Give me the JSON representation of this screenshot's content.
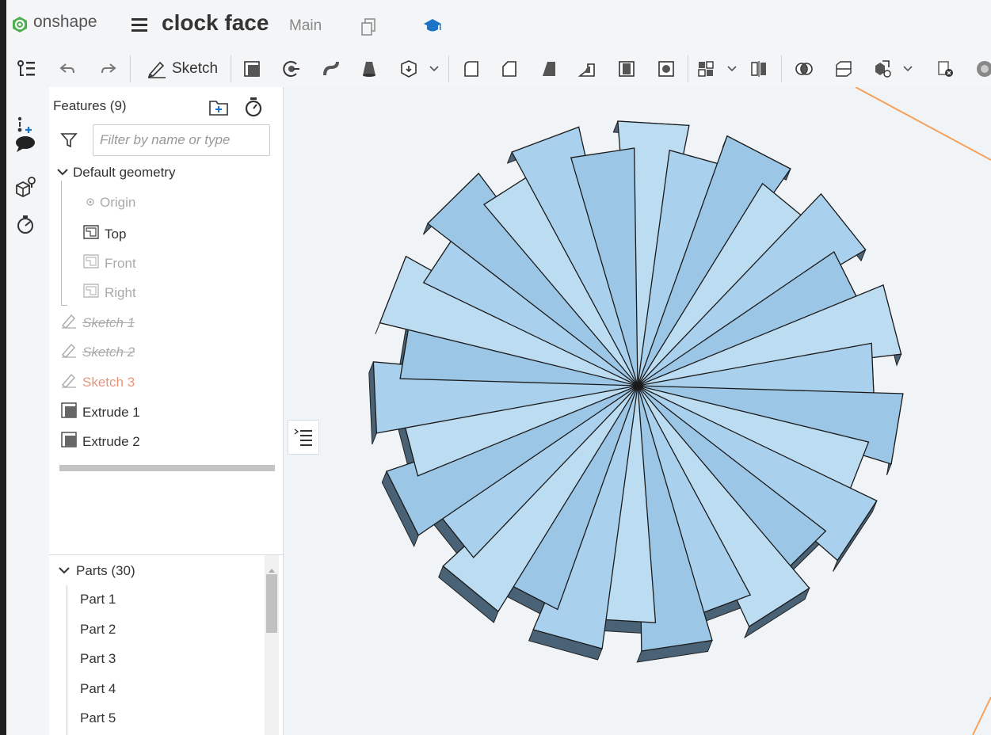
{
  "app": {
    "logo_text": "onshape"
  },
  "document": {
    "title": "clock face",
    "workspace": "Main"
  },
  "toolbar": {
    "sketch_label": "Sketch"
  },
  "features": {
    "title": "Features (9)",
    "filter_placeholder": "Filter by name or type",
    "group_label": "Default geometry",
    "origin": "Origin",
    "planes": [
      "Top",
      "Front",
      "Right"
    ],
    "sketches": [
      "Sketch 1",
      "Sketch 2",
      "Sketch 3"
    ],
    "extrudes": [
      "Extrude 1",
      "Extrude 2"
    ]
  },
  "parts": {
    "header": "Parts (30)",
    "items": [
      "Part 1",
      "Part 2",
      "Part 3",
      "Part 4",
      "Part 5"
    ]
  },
  "colors": {
    "brand_green": "#4caf50",
    "learn_blue": "#1a73c7",
    "part_fill": "#a9d0ec",
    "part_side": "#4a6275",
    "sketch_orange": "#e8957b",
    "axis_orange": "#f5a15a"
  }
}
